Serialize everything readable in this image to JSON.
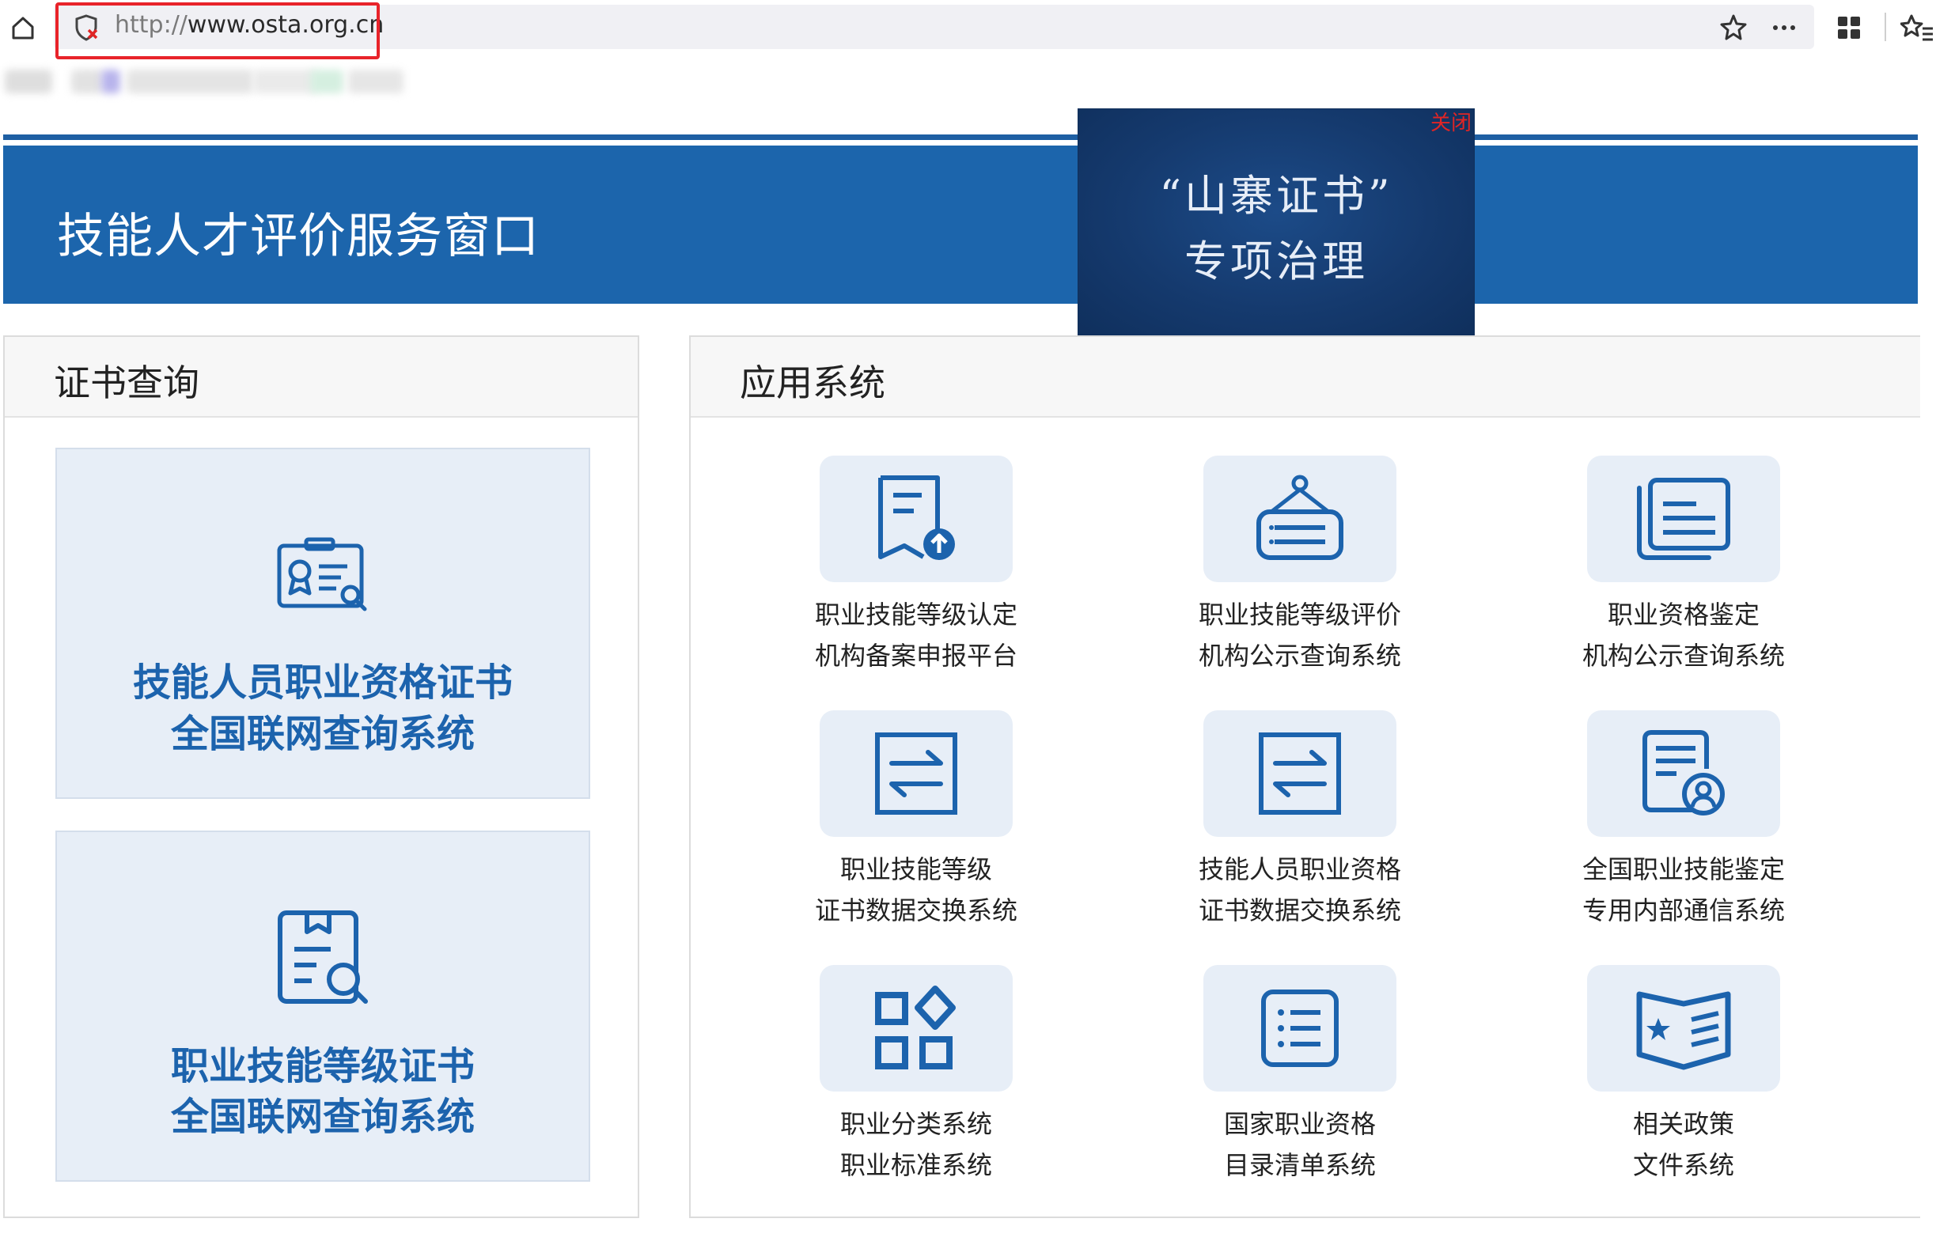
{
  "browser": {
    "url_protocol": "http://",
    "url_host": "www.osta.org.cn"
  },
  "header": {
    "site_title": "技能人才评价服务窗口",
    "promo_line1": "“山寨证书”",
    "promo_line2": "专项治理",
    "promo_close": "关闭"
  },
  "cert_panel": {
    "title": "证书查询",
    "cards": [
      {
        "line1": "技能人员职业资格证书",
        "line2": "全国联网查询系统",
        "icon": "certificate-search-icon"
      },
      {
        "line1": "职业技能等级证书",
        "line2": "全国联网查询系统",
        "icon": "document-search-icon"
      }
    ]
  },
  "app_panel": {
    "title": "应用系统",
    "items": [
      {
        "line1": "职业技能等级认定",
        "line2": "机构备案申报平台",
        "icon": "document-upload-icon"
      },
      {
        "line1": "职业技能等级评价",
        "line2": "机构公示查询系统",
        "icon": "notice-board-icon"
      },
      {
        "line1": "职业资格鉴定",
        "line2": "机构公示查询系统",
        "icon": "document-stack-icon"
      },
      {
        "line1": "职业技能等级",
        "line2": "证书数据交换系统",
        "icon": "data-exchange-icon"
      },
      {
        "line1": "技能人员职业资格",
        "line2": "证书数据交换系统",
        "icon": "data-exchange-icon"
      },
      {
        "line1": "全国职业技能鉴定",
        "line2": "专用内部通信系统",
        "icon": "document-user-icon"
      },
      {
        "line1": "职业分类系统",
        "line2": "职业标准系统",
        "icon": "category-grid-icon"
      },
      {
        "line1": "国家职业资格",
        "line2": "目录清单系统",
        "icon": "list-icon"
      },
      {
        "line1": "相关政策",
        "line2": "文件系统",
        "icon": "policy-book-icon"
      }
    ]
  },
  "colors": {
    "brand_blue": "#1c65ac",
    "promo_navy": "#153a6e",
    "card_bg": "#e7eef7",
    "icon_blue": "#1c63ad",
    "highlight_red": "#e8232a"
  }
}
